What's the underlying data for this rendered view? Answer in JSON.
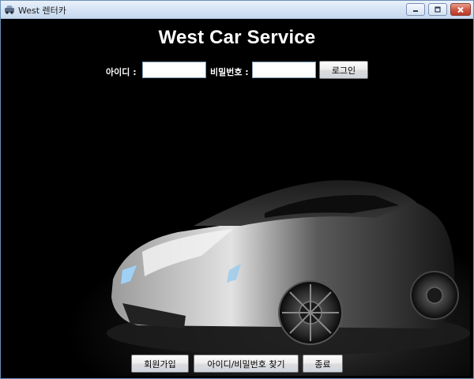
{
  "window": {
    "title": "West 렌터카",
    "icon": "car-icon"
  },
  "header": {
    "title": "West Car Service"
  },
  "login": {
    "id_label": "아이디 :",
    "id_value": "",
    "password_label": "비밀번호 :",
    "password_value": "",
    "login_button": "로그인"
  },
  "footer": {
    "signup_button": "회원가입",
    "find_button": "아이디/비밀번호 찾기",
    "exit_button": "종료"
  },
  "colors": {
    "background": "#000000",
    "text": "#ffffff",
    "car_body": "#c8c8c8"
  }
}
